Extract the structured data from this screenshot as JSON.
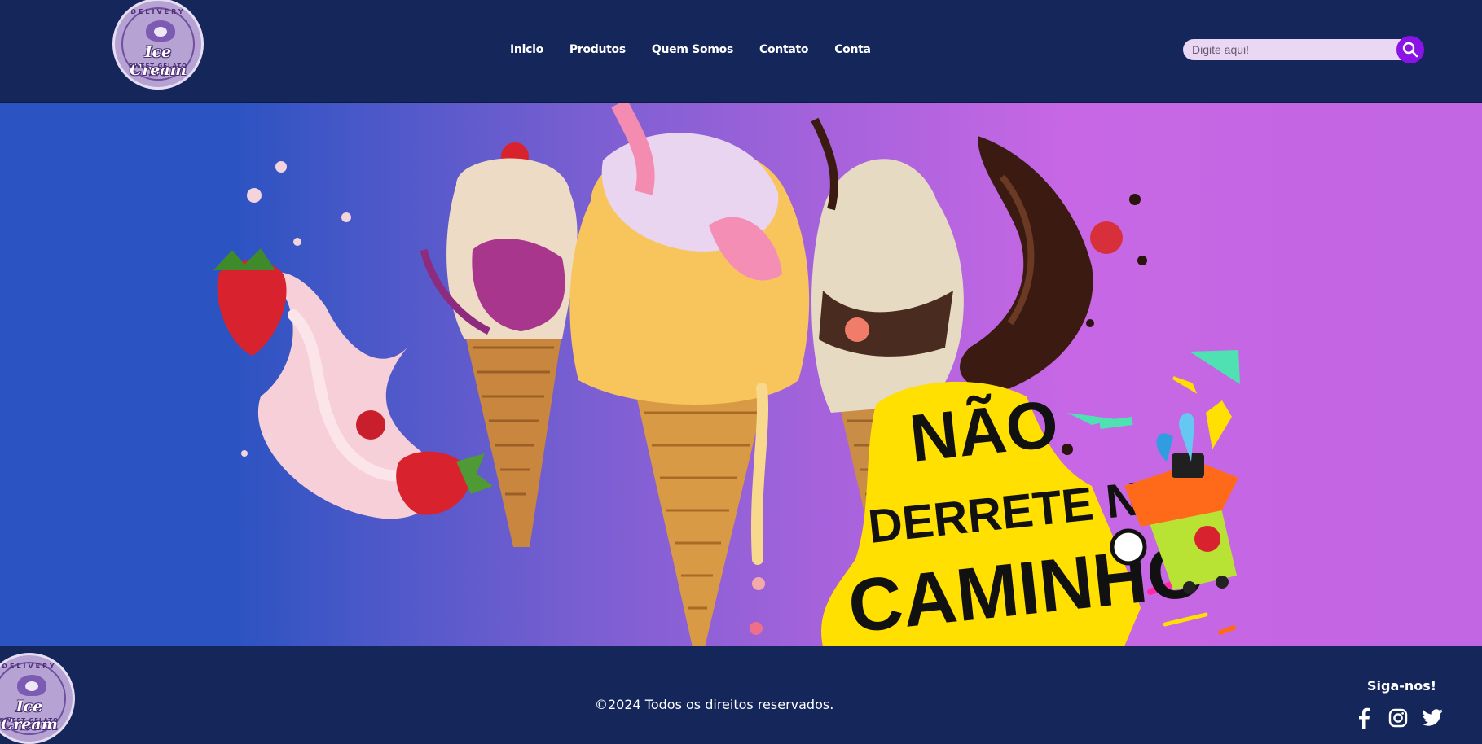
{
  "header": {
    "logo": {
      "arc_text": "DELIVERY",
      "brand": "Ice Cream",
      "tagline": "SWEET GELATO",
      "stars": "★★★"
    },
    "nav": [
      {
        "label": "Inicio"
      },
      {
        "label": "Produtos"
      },
      {
        "label": "Quem Somos"
      },
      {
        "label": "Contato"
      },
      {
        "label": "Conta"
      }
    ],
    "search": {
      "placeholder": "Digite aqui!",
      "value": "",
      "icon": "search-icon"
    }
  },
  "banner": {
    "headline_line1": "NÃO",
    "headline_line2": "DERRETE NO",
    "headline_line3": "CAMINHO",
    "gradient_colors": [
      "#2b53c2",
      "#7b5fd2",
      "#c767e5"
    ],
    "accent_yellow": "#ffe000"
  },
  "footer": {
    "copyright": "©2024 Todos os direitos reservados.",
    "follow_label": "Siga-nos!",
    "socials": [
      {
        "icon": "facebook-icon"
      },
      {
        "icon": "instagram-icon"
      },
      {
        "icon": "twitter-icon"
      }
    ]
  },
  "colors": {
    "navy": "#14265a",
    "search_bg": "#ead7f4",
    "search_button": "#8a13e6"
  }
}
